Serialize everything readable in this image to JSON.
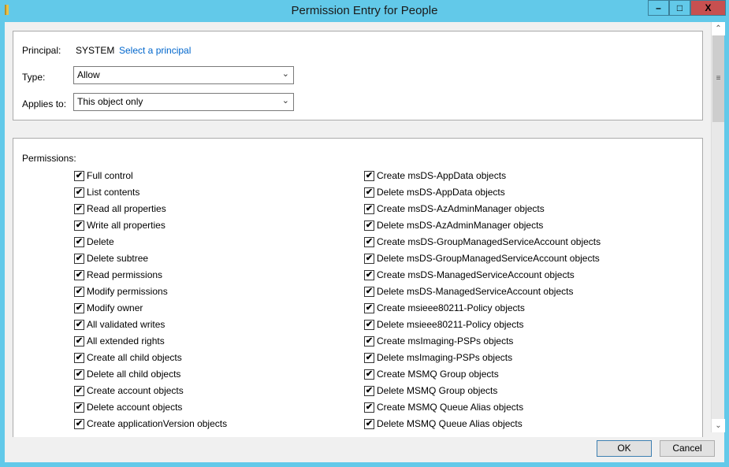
{
  "window": {
    "title": "Permission Entry for People",
    "minimize": "–",
    "maximize": "□",
    "close": "X"
  },
  "principal": {
    "label": "Principal:",
    "value": "SYSTEM",
    "link": "Select a principal"
  },
  "type": {
    "label": "Type:",
    "value": "Allow"
  },
  "applies": {
    "label": "Applies to:",
    "value": "This object only"
  },
  "permissions": {
    "label": "Permissions:",
    "left": [
      {
        "label": "Full control",
        "checked": true
      },
      {
        "label": "List contents",
        "checked": true
      },
      {
        "label": "Read all properties",
        "checked": true
      },
      {
        "label": "Write all properties",
        "checked": true
      },
      {
        "label": "Delete",
        "checked": true
      },
      {
        "label": "Delete subtree",
        "checked": true
      },
      {
        "label": "Read permissions",
        "checked": true
      },
      {
        "label": "Modify permissions",
        "checked": true
      },
      {
        "label": "Modify owner",
        "checked": true
      },
      {
        "label": "All validated writes",
        "checked": true
      },
      {
        "label": "All extended rights",
        "checked": true
      },
      {
        "label": "Create all child objects",
        "checked": true
      },
      {
        "label": "Delete all child objects",
        "checked": true
      },
      {
        "label": "Create account objects",
        "checked": true
      },
      {
        "label": "Delete account objects",
        "checked": true
      },
      {
        "label": "Create applicationVersion objects",
        "checked": true
      }
    ],
    "right": [
      {
        "label": "Create msDS-AppData objects",
        "checked": true
      },
      {
        "label": "Delete msDS-AppData objects",
        "checked": true
      },
      {
        "label": "Create msDS-AzAdminManager objects",
        "checked": true
      },
      {
        "label": "Delete msDS-AzAdminManager objects",
        "checked": true
      },
      {
        "label": "Create msDS-GroupManagedServiceAccount objects",
        "checked": true
      },
      {
        "label": "Delete msDS-GroupManagedServiceAccount objects",
        "checked": true
      },
      {
        "label": "Create msDS-ManagedServiceAccount objects",
        "checked": true
      },
      {
        "label": "Delete msDS-ManagedServiceAccount objects",
        "checked": true
      },
      {
        "label": "Create msieee80211-Policy objects",
        "checked": true
      },
      {
        "label": "Delete msieee80211-Policy objects",
        "checked": true
      },
      {
        "label": "Create msImaging-PSPs objects",
        "checked": true
      },
      {
        "label": "Delete msImaging-PSPs objects",
        "checked": true
      },
      {
        "label": "Create MSMQ Group objects",
        "checked": true
      },
      {
        "label": "Delete MSMQ Group objects",
        "checked": true
      },
      {
        "label": "Create MSMQ Queue Alias objects",
        "checked": true
      },
      {
        "label": "Delete MSMQ Queue Alias objects",
        "checked": true
      }
    ]
  },
  "buttons": {
    "ok": "OK",
    "cancel": "Cancel"
  }
}
